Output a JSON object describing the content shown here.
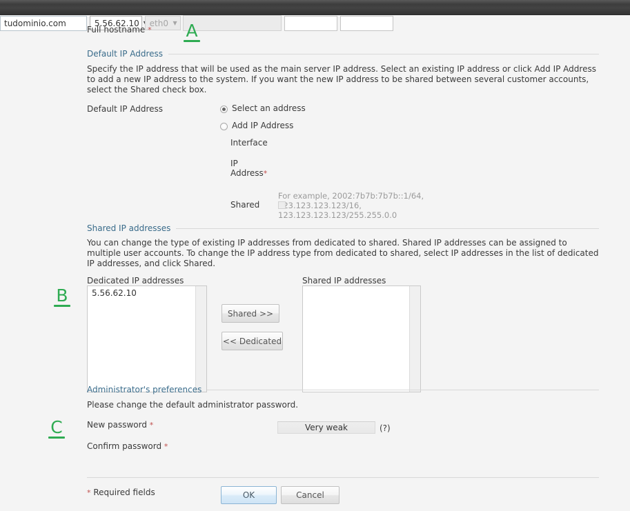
{
  "topbar": {
    "name": "browser-chrome-bar"
  },
  "hostname": {
    "label": "Full hostname",
    "required_mark": "*",
    "value": "tudominio.com"
  },
  "default_ip_section": {
    "title": "Default IP Address",
    "description": "Specify the IP address that will be used as the main server IP address. Select an existing IP address or click Add IP Address to add a new IP address to the system. If you want the new IP address to be shared between several customer accounts, select the Shared check box.",
    "field_label": "Default IP Address",
    "select_radio_label": "Select an address",
    "select_value": "5.56.62.10",
    "select_options": [
      "5.56.62.10"
    ],
    "add_radio_label": "Add IP Address",
    "interface_label": "Interface",
    "interface_value": "eth0",
    "interface_options": [
      "eth0"
    ],
    "ip_address_label_line1": "IP",
    "ip_address_label_line2": "Address",
    "ip_address_required": "*",
    "ip_address_value": "",
    "ip_hint_line1": "For example, 2002:7b7b:7b7b::1/64, 123.123.123.123/16,",
    "ip_hint_line2": "123.123.123.123/255.255.0.0",
    "shared_label": "Shared",
    "shared_checked": false
  },
  "shared_ip_section": {
    "title": "Shared IP addresses",
    "description": "You can change the type of existing IP addresses from dedicated to shared. Shared IP addresses can be assigned to multiple user accounts. To change the IP address type from dedicated to shared, select IP addresses in the list of dedicated IP addresses, and click Shared.",
    "dedicated_label": "Dedicated IP addresses",
    "dedicated_items": [
      "5.56.62.10"
    ],
    "shared_label": "Shared IP addresses",
    "shared_items": [],
    "shared_button": "Shared >>",
    "dedicated_button": "<< Dedicated"
  },
  "admin_section": {
    "title": "Administrator's preferences",
    "description": "Please change the default administrator password.",
    "new_password_label": "New password",
    "new_password_required": "*",
    "new_password_value": "",
    "confirm_password_label": "Confirm password",
    "confirm_password_required": "*",
    "confirm_password_value": "",
    "strength_text": "Very weak",
    "help_text": "(?)"
  },
  "footer": {
    "required_note_mark": "*",
    "required_note": "Required fields",
    "ok_label": "OK",
    "cancel_label": "Cancel"
  },
  "annotations": [
    {
      "letter": "A"
    },
    {
      "letter": "B"
    },
    {
      "letter": "C"
    }
  ],
  "colors": {
    "section_header": "#396b8a",
    "required_star": "#c0504d",
    "annotation_green": "#2eab52",
    "page_bg": "#f4f4f4",
    "topbar": "#3d3d3d"
  }
}
